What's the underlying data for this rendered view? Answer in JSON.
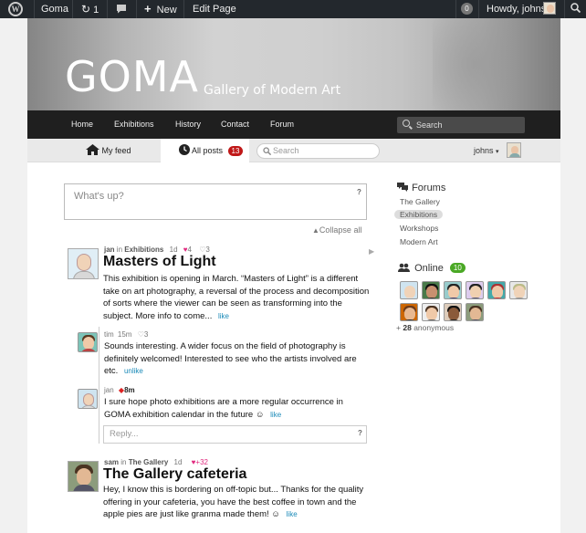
{
  "admin_bar": {
    "site_name": "Goma",
    "updates_count": "1",
    "new_label": "New",
    "edit_label": "Edit Page",
    "notifications_count": "0",
    "howdy": "Howdy, johns"
  },
  "site": {
    "title": "GOMA",
    "tagline": "Gallery of Modern Art"
  },
  "nav": {
    "items": [
      "Home",
      "Exhibitions",
      "History",
      "Contact",
      "Forum"
    ],
    "search_placeholder": "Search"
  },
  "subbar": {
    "my_feed": "My feed",
    "all_posts": "All posts",
    "all_posts_count": "13",
    "search_placeholder": "Search",
    "username": "johns"
  },
  "composer": {
    "placeholder": "What's up?",
    "help": "?"
  },
  "collapse_all": "Collapse all",
  "posts": [
    {
      "author": "jan",
      "in_label": "in",
      "forum": "Exhibitions",
      "time": "1d",
      "likes": "4",
      "comments": "3",
      "title": "Masters of Light",
      "text": "This exhibition is opening in March. “Masters of Light” is a different take on art photography, a reversal of the process and decomposition of sorts where the viewer can be seen as transforming into the subject. More info to come...",
      "like_label": "like",
      "comments_list": [
        {
          "author": "tim",
          "time": "15m",
          "likes": "3",
          "text": "Sounds interesting. A wider focus on the field of photography is definitely welcomed! Interested to see who the artists involved are etc.",
          "action": "unlike"
        },
        {
          "author": "jan",
          "time": "8m",
          "text": "I sure hope photo exhibitions are a more regular occurrence in GOMA exhibition calendar in the future ☺",
          "action": "like"
        }
      ],
      "reply_placeholder": "Reply...",
      "reply_help": "?"
    },
    {
      "author": "sam",
      "in_label": "in",
      "forum": "The Gallery",
      "time": "1d",
      "likes": "+32",
      "title": "The Gallery cafeteria",
      "text": "Hey, I know this is bordering on off-topic but... Thanks for the quality offering in your cafeteria, you have the best coffee in town and the apple pies are just like granma made them! ☺",
      "like_label": "like"
    }
  ],
  "sidebar": {
    "forums_title": "Forums",
    "forums": [
      "The Gallery",
      "Exhibitions",
      "Workshops",
      "Modern Art"
    ],
    "active_forum": "Exhibitions",
    "online_title": "Online",
    "online_count": "10",
    "anonymous_prefix": "+",
    "anonymous_count": "28",
    "anonymous_label": "anonymous"
  }
}
